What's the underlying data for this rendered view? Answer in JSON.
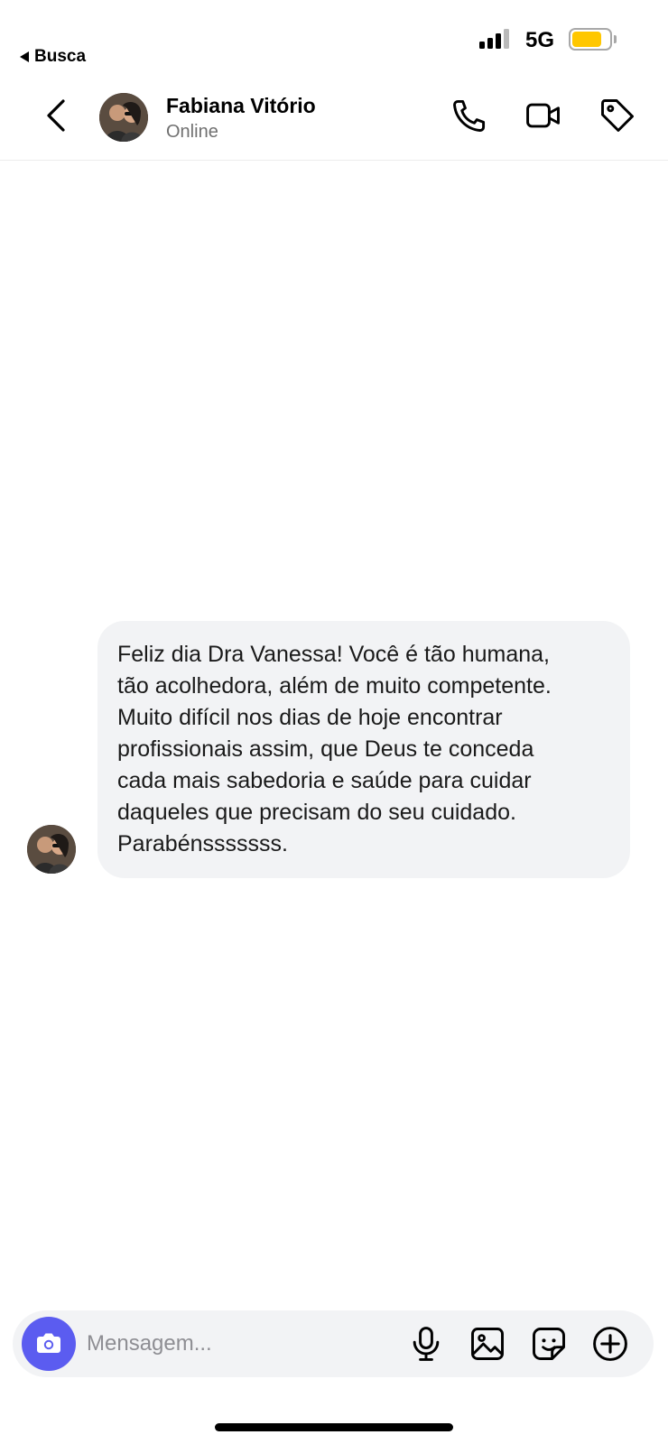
{
  "status_bar": {
    "back_app_label": "Busca",
    "network": "5G",
    "battery_level": 0.8,
    "battery_color": "#ffc700"
  },
  "header": {
    "contact_name": "Fabiana Vitório",
    "contact_status": "Online",
    "icons": [
      "back-chevron-icon",
      "phone-icon",
      "video-camera-icon",
      "tag-icon"
    ]
  },
  "messages": [
    {
      "direction": "incoming",
      "text_lines": [
        "Feliz dia Dra Vanessa! Você é tão humana,",
        "tão acolhedora, além de muito competente.",
        "Muito difícil nos dias de hoje encontrar",
        "profissionais assim, que Deus te conceda",
        "cada mais sabedoria e saúde para cuidar",
        "daqueles que precisam do seu cuidado.",
        "Parabénsssssss."
      ]
    }
  ],
  "composer": {
    "placeholder": "Mensagem...",
    "accent_color": "#5b5cf0",
    "icons": [
      "camera-icon",
      "microphone-icon",
      "gallery-icon",
      "sticker-icon",
      "add-icon"
    ]
  }
}
